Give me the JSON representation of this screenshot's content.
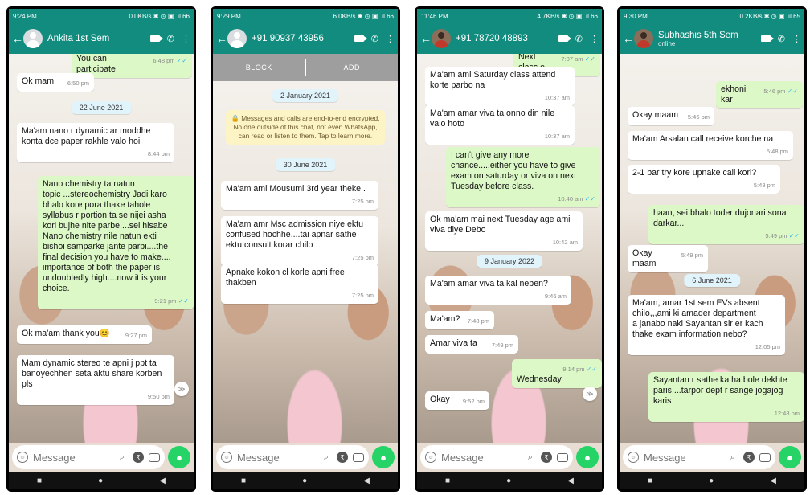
{
  "phones": [
    {
      "status_time": "9:24 PM",
      "status_right": "...0.0KB/s ✱ ◷ ▣ .ıl 66",
      "contact": "Ankita 1st Sem",
      "contact_sub": "",
      "date_pills": [
        "22 June 2021"
      ],
      "messages": [
        {
          "text": "You can participate",
          "time": "6:48 pm",
          "read": "✓✓"
        },
        {
          "text": "Ok mam",
          "time": "6:50 pm"
        },
        {
          "text": "Ma'am nano r dynamic ar moddhe\nkonta dce paper rakhle valo hoi",
          "time": "8:44 pm"
        },
        {
          "text": "Nano chemistry ta natun\ntopic ...stereochemistry Jadi karo\nbhalo kore pora thake tahole\nsyllabus r portion ta se nijei asha\nkori bujhe nite parbe....sei hisabe\nNano chemistry nile natun ekti\nbishoi samparke jante parbi....the\nfinal decision you have to make....\nimportance of both the paper is\nundoubtedly high....now it is your\nchoice.",
          "time": "9:21 pm",
          "read": "✓✓"
        },
        {
          "text": "Ok ma'am thank you😊",
          "time": "9:27 pm"
        },
        {
          "text": "Mam dynamic stereo te apni j ppt ta\nbanoyechhen seta aktu share korben\npls",
          "time": "9:50 pm"
        }
      ],
      "composer_placeholder": "Message"
    },
    {
      "status_time": "9:29 PM",
      "status_right": "6.0KB/s ✱ ◷ ▣ .ıl 66",
      "contact": "+91 90937 43956",
      "contact_sub": "",
      "action_block": "BLOCK",
      "action_add": "ADD",
      "date_pills": [
        "2 January 2021",
        "30 June 2021"
      ],
      "encryption_notice": "🔒 Messages and calls are end-to-end encrypted. No one outside of this chat, not even WhatsApp, can read or listen to them. Tap to learn more.",
      "messages": [
        {
          "text": "Ma'am ami Mousumi 3rd year theke..",
          "time": "7:25 pm"
        },
        {
          "text": "Ma'am amr Msc admission niye ektu\nconfused hochhe....tai apnar sathe\nektu consult korar chilo",
          "time": "7:25 pm"
        },
        {
          "text": "Apnake kokon cl korle apni free\nthakben",
          "time": "7:25 pm"
        }
      ],
      "composer_placeholder": "Message"
    },
    {
      "status_time": "11:46 PM",
      "status_right": "...4.7KB/s ✱ ◷ ▣ .ıl 66",
      "contact": "+91 78720 48893",
      "contact_sub": "",
      "date_pills": [
        "9 January 2022"
      ],
      "messages": [
        {
          "text": "Next class e",
          "time": "7:07 am",
          "read": "✓✓"
        },
        {
          "text": "Ma'am ami Saturday class attend\nkorte parbo na",
          "time": "10:37 am"
        },
        {
          "text": "Ma'am amar viva ta onno din nile\nvalo hoto",
          "time": "10:37 am"
        },
        {
          "text": "I can't give any more\nchance.....either you have to give\nexam on saturday or viva on next\nTuesday before class.",
          "time": "10:40 am",
          "read": "✓✓"
        },
        {
          "text": "Ok ma'am mai next Tuesday age ami\nviva diye Debo",
          "time": "10:42 am"
        },
        {
          "text": "Ma'am amar viva ta kal neben?",
          "time": "9:46 am"
        },
        {
          "text": "Ma'am?",
          "time": "7:48 pm"
        },
        {
          "text": "Amar viva ta",
          "time": "7:49 pm"
        },
        {
          "text": "Wednesday",
          "time": "9:14 pm",
          "read": "✓✓"
        },
        {
          "text": "Okay",
          "time": "9:52 pm"
        }
      ],
      "composer_placeholder": "Message"
    },
    {
      "status_time": "9:30 PM",
      "status_right": "...0.2KB/s ✱ ◷ ▣ .ıl 65",
      "contact": "Subhashis 5th Sem",
      "contact_sub": "online",
      "date_pills": [
        "6 June 2021"
      ],
      "messages": [
        {
          "text": "ekhoni kar",
          "time": "5:46 pm",
          "read": "✓✓"
        },
        {
          "text": "Okay maam",
          "time": "5:46 pm"
        },
        {
          "text": "Ma'am Arsalan call receive korche na",
          "time": "5:48 pm"
        },
        {
          "text": "2-1 bar try kore upnake call kori?",
          "time": "5:48 pm"
        },
        {
          "text": "haan, sei bhalo toder dujonari sona\ndarkar...",
          "time": "5:49 pm",
          "read": "✓✓"
        },
        {
          "text": "Okay maam",
          "time": "5:49 pm"
        },
        {
          "text": "Ma'am, amar 1st sem EVs absent\nchilo,,,ami ki amader department\na janabo naki Sayantan sir er kach\nthake exam information nebo?",
          "time": "12:05 pm"
        },
        {
          "text": "Sayantan r sathe katha bole dekhte\nparis....tarpor dept r sange jogajog\nkaris",
          "time": "12:48 pm"
        }
      ],
      "composer_placeholder": "Message"
    }
  ],
  "colors": {
    "header": "#128c7e",
    "outgoing": "#dcf8c6",
    "incoming": "#ffffff",
    "mic": "#25d366"
  },
  "icons": [
    "back-arrow-icon",
    "video-call-icon",
    "phone-icon",
    "more-vert-icon",
    "emoji-icon",
    "attach-icon",
    "rupee-icon",
    "camera-icon",
    "mic-icon",
    "nav-back-icon",
    "nav-home-icon",
    "nav-recents-icon"
  ]
}
